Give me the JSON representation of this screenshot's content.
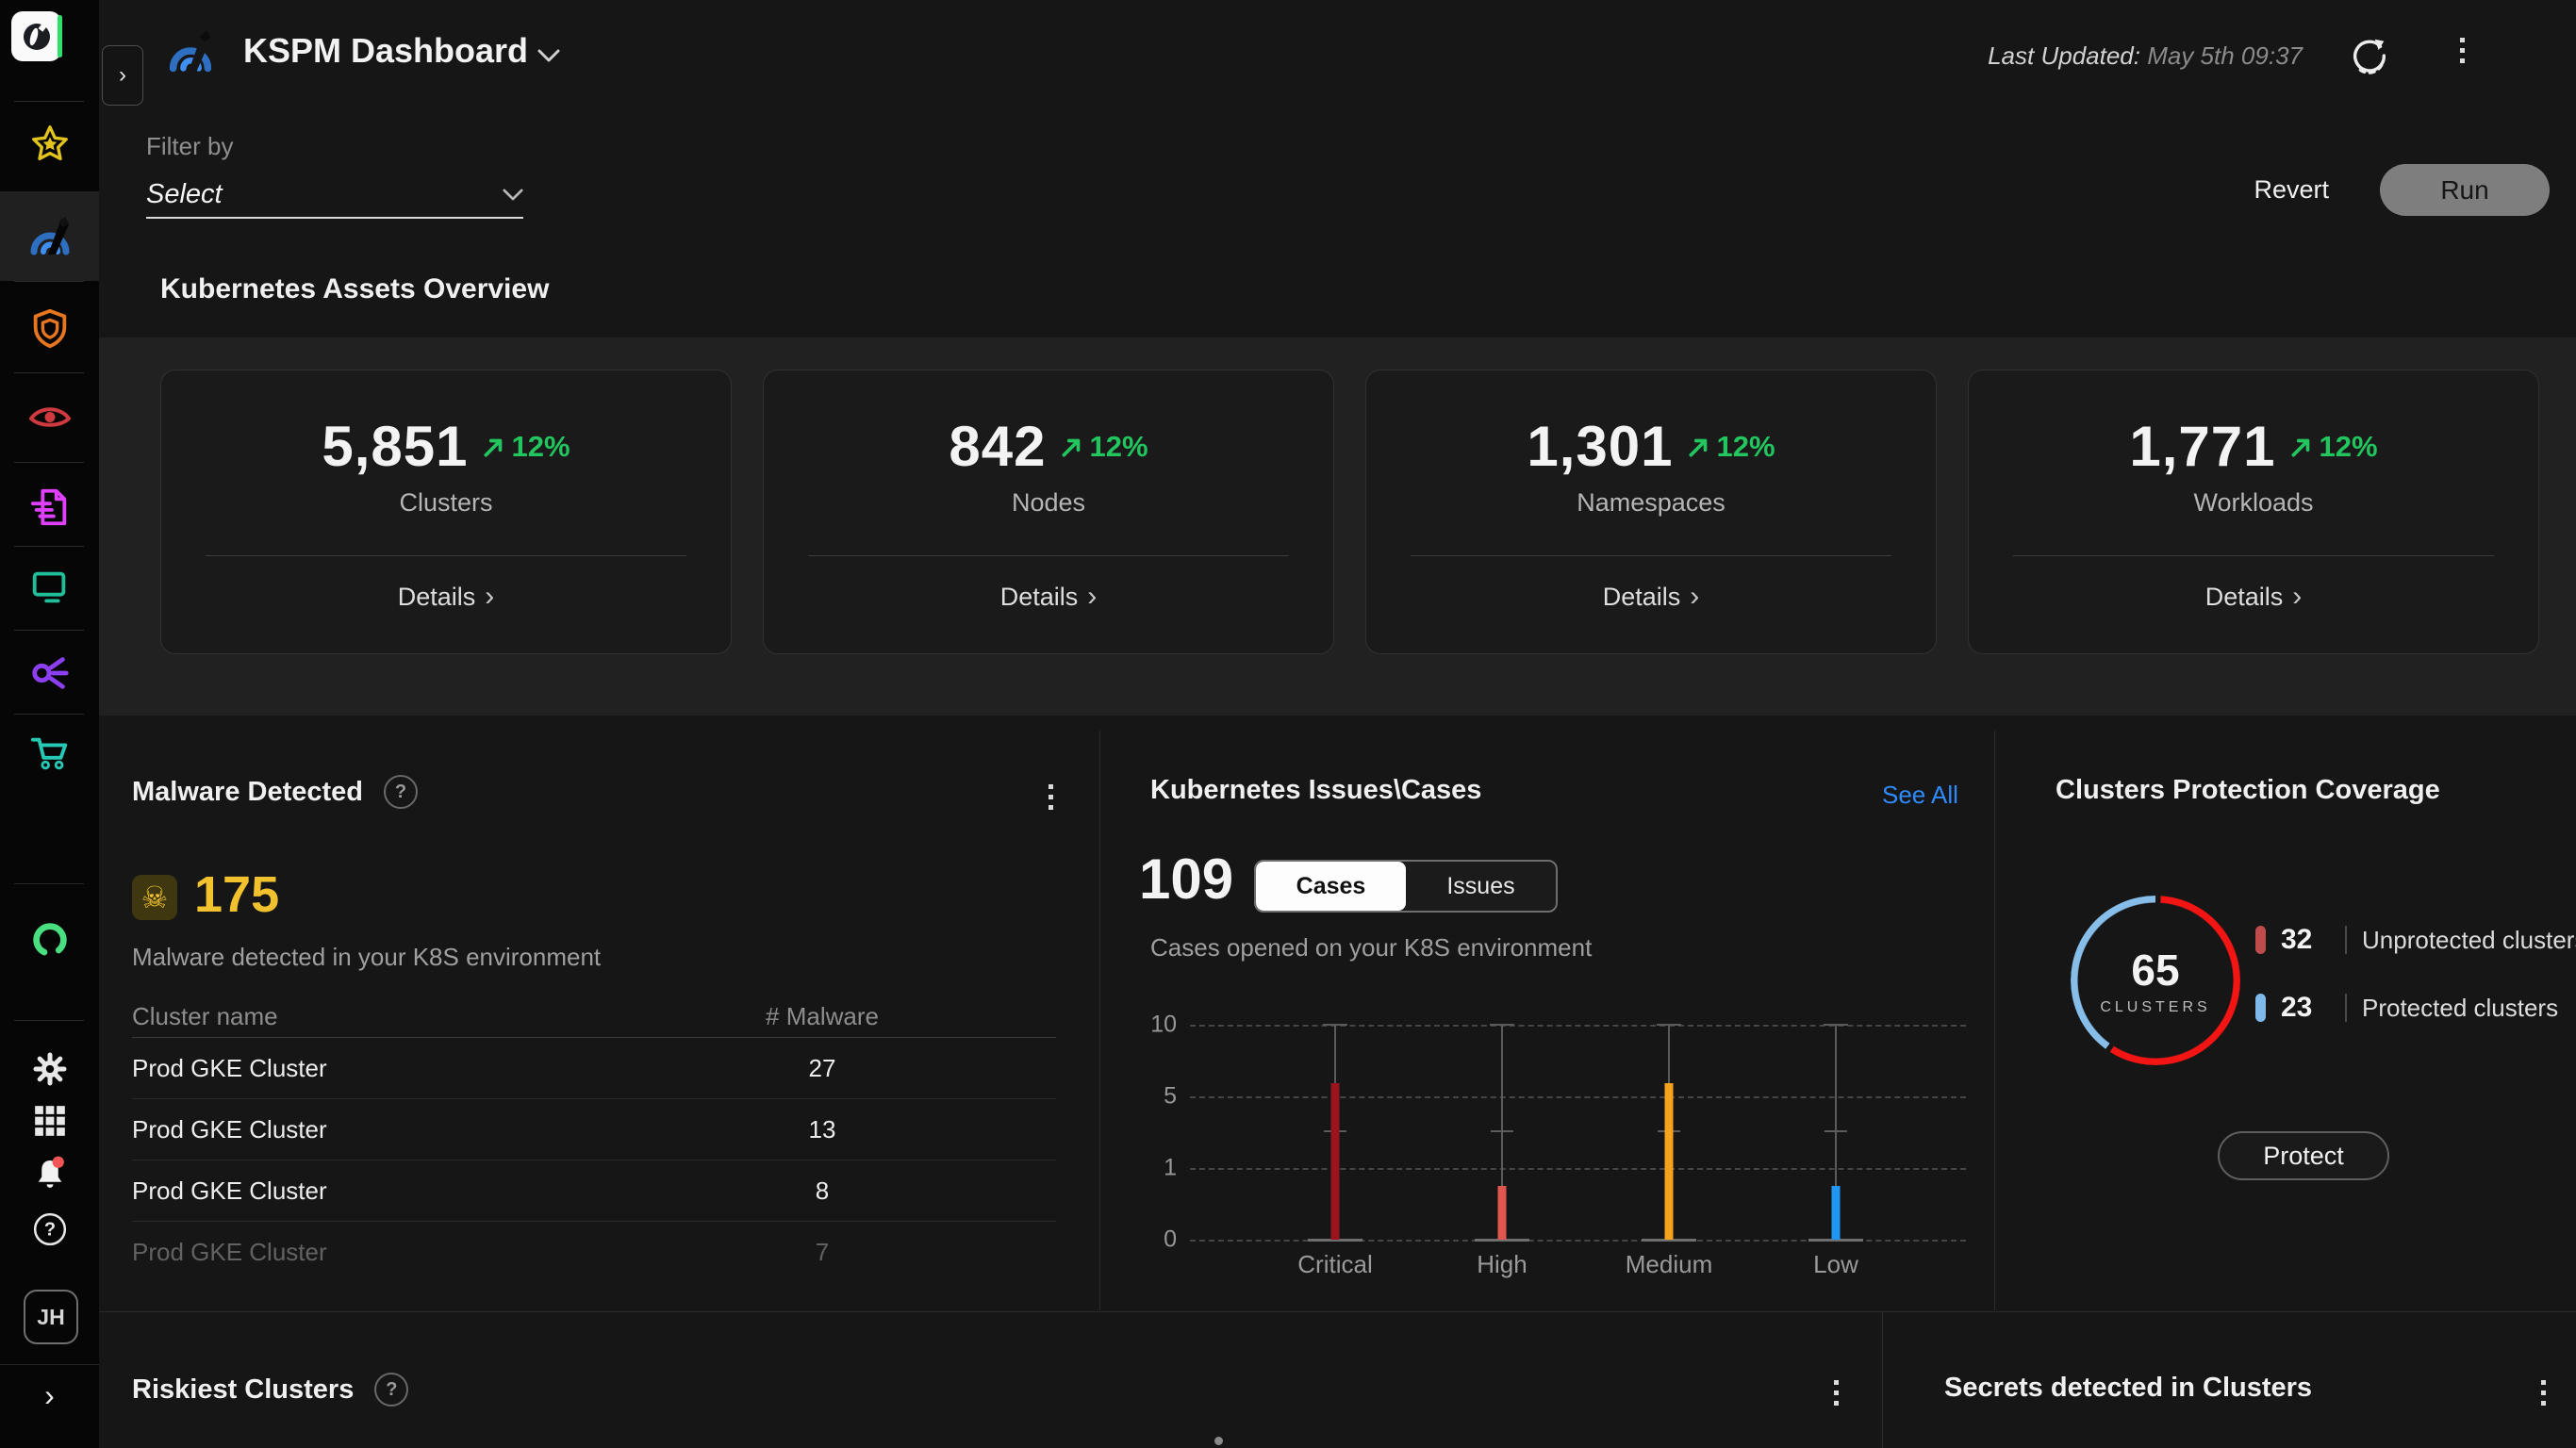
{
  "header": {
    "title": "KSPM Dashboard",
    "last_updated_label": "Last Updated:",
    "last_updated_value": "May 5th 09:37"
  },
  "filter": {
    "label": "Filter by",
    "selected": "Select"
  },
  "actions": {
    "revert": "Revert",
    "run": "Run"
  },
  "assets_overview": {
    "title": "Kubernetes Assets Overview",
    "details_label": "Details",
    "delta_color": "#22c55e",
    "cards": [
      {
        "value": "5,851",
        "delta": "12%",
        "label": "Clusters"
      },
      {
        "value": "842",
        "delta": "12%",
        "label": "Nodes"
      },
      {
        "value": "1,301",
        "delta": "12%",
        "label": "Namespaces"
      },
      {
        "value": "1,771",
        "delta": "12%",
        "label": "Workloads"
      }
    ]
  },
  "malware": {
    "title": "Malware Detected",
    "count": "175",
    "accent_color": "#f2c12e",
    "subtitle": "Malware detected in your K8S environment",
    "table": {
      "columns": [
        "Cluster name",
        "# Malware"
      ],
      "rows": [
        [
          "Prod GKE Cluster",
          "27"
        ],
        [
          "Prod GKE Cluster",
          "13"
        ],
        [
          "Prod GKE Cluster",
          "8"
        ],
        [
          "Prod GKE Cluster",
          "7"
        ]
      ]
    }
  },
  "issues": {
    "title": "Kubernetes Issues\\Cases",
    "see_all": "See All",
    "count": "109",
    "tabs": [
      {
        "label": "Cases",
        "active": true
      },
      {
        "label": "Issues",
        "active": false
      }
    ],
    "subtitle": "Cases opened on your K8S environment",
    "chart_data": {
      "type": "bar",
      "categories": [
        "Critical",
        "High",
        "Medium",
        "Low"
      ],
      "values": [
        5.9,
        0.75,
        5.9,
        0.75
      ],
      "colors": [
        "#9a141d",
        "#e0574f",
        "#f5a31d",
        "#2196f3"
      ],
      "y_ticks": [
        0,
        1,
        5,
        10
      ],
      "y_scale": "even-tick-spacing",
      "whisker_max": 10,
      "whisker_mid": 3,
      "grid": "dashed horizontal"
    }
  },
  "coverage": {
    "title": "Clusters Protection Coverage",
    "total": "65",
    "total_label": "CLUSTERS",
    "donut": {
      "segments": [
        {
          "pct": 58,
          "color": "#f31414"
        },
        {
          "pct": 41,
          "color": "#86bde9"
        }
      ],
      "gap_pct": 1
    },
    "legend": [
      {
        "value": "32",
        "label": "Unprotected clusters",
        "swatch_color": "#bf4b4b"
      },
      {
        "value": "23",
        "label": "Protected clusters",
        "swatch_color": "#7fb9ea"
      }
    ],
    "protect_button": "Protect"
  },
  "bottom": {
    "riskiest_title": "Riskiest Clusters",
    "secrets_title": "Secrets detected in Clusters"
  },
  "sidebar": {
    "avatar": "JH",
    "active_index": 1,
    "items": [
      {
        "icon": "star-icon",
        "color": "#e3c41c"
      },
      {
        "icon": "kspm-arcs-icon",
        "color": "#3f8ef0"
      },
      {
        "icon": "shield-icon",
        "color": "#e8761f"
      },
      {
        "icon": "eye-icon",
        "color": "#cf3a40"
      },
      {
        "icon": "report-icon",
        "color": "#e040fb"
      },
      {
        "icon": "monitor-icon",
        "color": "#1fbf9a"
      },
      {
        "icon": "share-icon",
        "color": "#8b3ff0"
      },
      {
        "icon": "cart-icon",
        "color": "#25c9b5"
      },
      {
        "icon": "loop-icon",
        "color": "#49de80"
      },
      {
        "icon": "gear-icon",
        "color": "#e8e8e8"
      },
      {
        "icon": "apps-grid-icon",
        "color": "#e8e8e8"
      },
      {
        "icon": "bell-icon",
        "color": "#f2f2f2"
      },
      {
        "icon": "help-icon",
        "color": "#e8e8e8"
      }
    ]
  }
}
